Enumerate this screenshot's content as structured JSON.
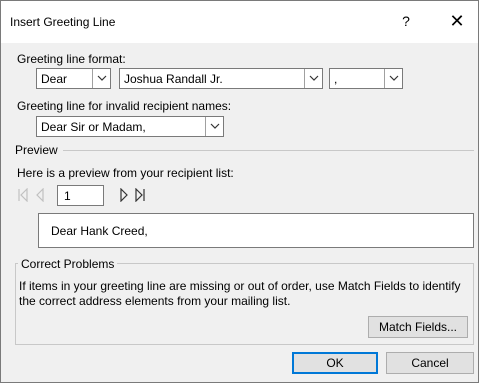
{
  "dialog": {
    "title": "Insert Greeting Line",
    "help_label": "?",
    "close_label": "✕"
  },
  "greeting_format": {
    "label": "Greeting line format:",
    "salutation": "Dear",
    "name_format": "Joshua Randall Jr.",
    "punctuation": ","
  },
  "invalid_names": {
    "label": "Greeting line for invalid recipient names:",
    "value": "Dear Sir or Madam,"
  },
  "preview": {
    "section_label": "Preview",
    "description": "Here is a preview from your recipient list:",
    "record_number": "1",
    "preview_text": "Dear Hank Creed,"
  },
  "correct_problems": {
    "section_label": "Correct Problems",
    "description": "If items in your greeting line are missing or out of order, use Match Fields to identify the correct address elements from your mailing list.",
    "match_fields_label": "Match Fields..."
  },
  "buttons": {
    "ok_label": "OK",
    "cancel_label": "Cancel"
  }
}
